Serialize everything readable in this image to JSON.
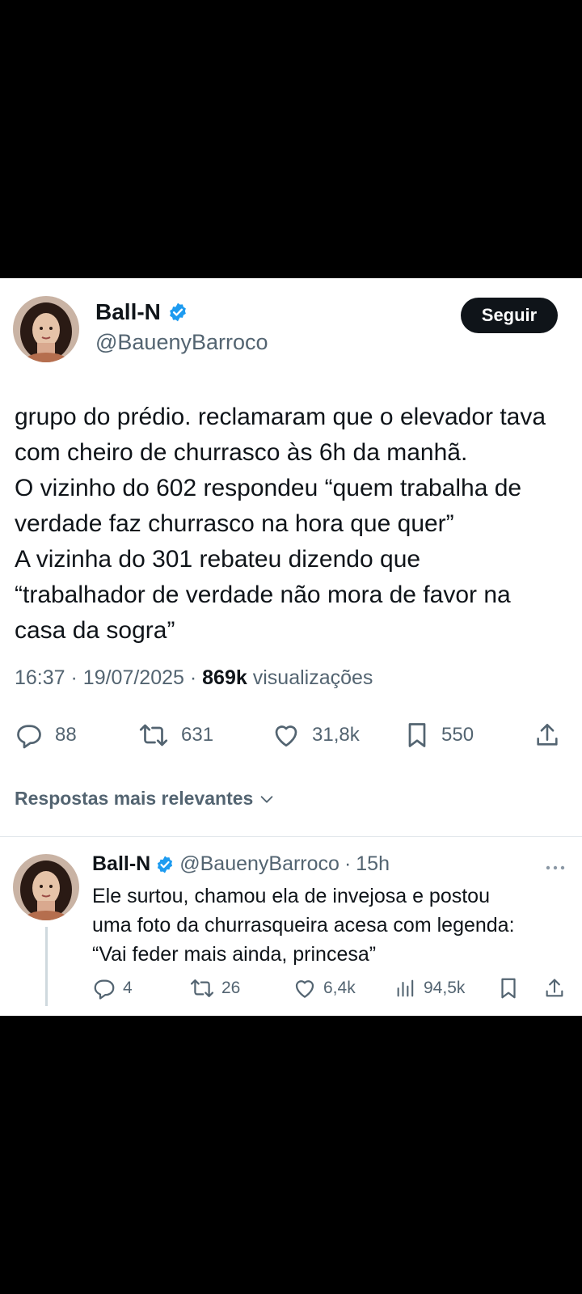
{
  "tweet": {
    "author_name": "Ball-N",
    "author_handle": "@BauenyBarroco",
    "follow_label": "Seguir",
    "text_lines": [
      "grupo do prédio. reclamaram que o elevador tava",
      "com cheiro de churrasco às 6h da manhã.",
      "O vizinho do 602 respondeu “quem trabalha de",
      "verdade faz churrasco na hora que quer”",
      "A vizinha do 301 rebateu dizendo que",
      "“trabalhador de verdade não mora de favor na",
      "casa da sogra”"
    ],
    "time": "16:37",
    "date": "19/07/2025",
    "views": "869k",
    "views_label": "visualizações",
    "stats": {
      "replies": "88",
      "retweets": "631",
      "likes": "31,8k",
      "bookmarks": "550"
    }
  },
  "sort_label": "Respostas mais relevantes",
  "reply": {
    "author_name": "Ball-N",
    "author_handle": "@BauenyBarroco",
    "time_ago": "15h",
    "text_lines": [
      "Ele surtou, chamou ela de invejosa e postou",
      "uma foto da churrasqueira acesa com legenda:",
      "“Vai feder mais ainda, princesa”"
    ],
    "stats": {
      "replies": "4",
      "retweets": "26",
      "likes": "6,4k",
      "views": "94,5k"
    }
  },
  "colors": {
    "verified": "#1d9bf0",
    "text": "#0f1419",
    "secondary": "#536471"
  }
}
